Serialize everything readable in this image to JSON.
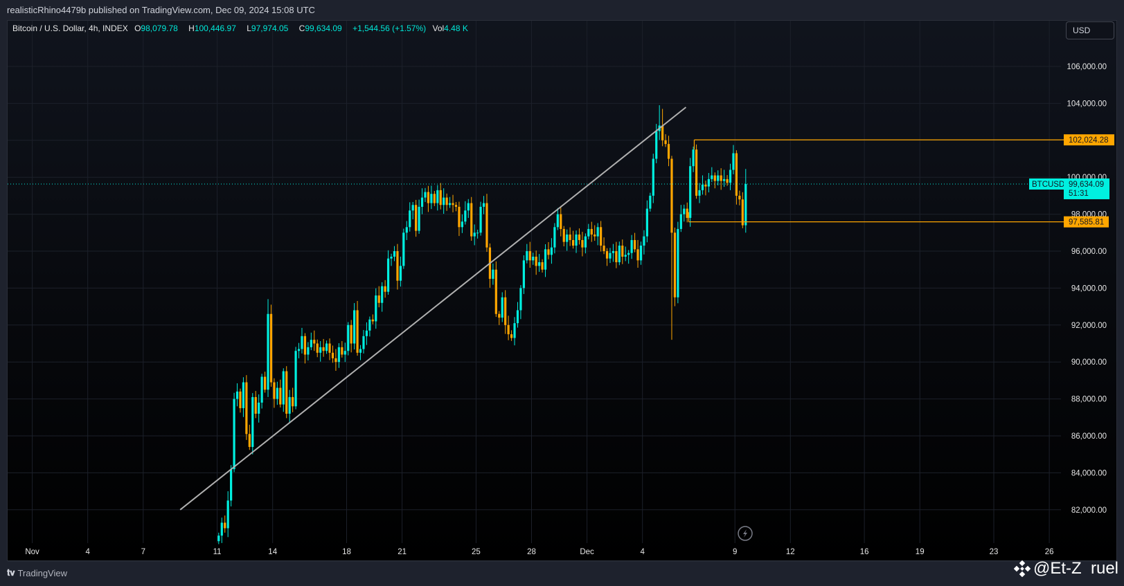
{
  "header": {
    "publisher_line": "realisticRhino4479b published on TradingView.com, Dec 09, 2024 15:08 UTC"
  },
  "legend": {
    "symbol": "Bitcoin / U.S. Dollar, 4h, INDEX",
    "open_label": "O",
    "open": "98,079.78",
    "high_label": "H",
    "high": "100,446.97",
    "low_label": "L",
    "low": "97,974.05",
    "close_label": "C",
    "close": "99,634.09",
    "change": "+1,544.56 (+1.57%)",
    "vol_label": "Vol",
    "vol": "4.48 K"
  },
  "currency_button": "USD",
  "footer": {
    "logo_text": "TradingView",
    "watermark": "@Et-Z  ruel"
  },
  "colors": {
    "up": "#00f0e0",
    "down": "#ffa600",
    "trendline": "#b0b0b0",
    "level": "#ffa600",
    "last_price": "#00f0e0"
  },
  "chart_data": {
    "type": "candlestick",
    "interval": "4h",
    "start": "Nov 11 00:00",
    "y_ticks": [
      "82,000.00",
      "84,000.00",
      "86,000.00",
      "88,000.00",
      "90,000.00",
      "92,000.00",
      "94,000.00",
      "96,000.00",
      "98,000.00",
      "100,000.00",
      "102,000.00",
      "104,000.00",
      "106,000.00"
    ],
    "ylim": [
      81000,
      107500
    ],
    "x_ticks": [
      {
        "label": "Nov",
        "day": -10
      },
      {
        "label": "4",
        "day": -7
      },
      {
        "label": "7",
        "day": -4
      },
      {
        "label": "11",
        "day": 0
      },
      {
        "label": "14",
        "day": 3
      },
      {
        "label": "18",
        "day": 7
      },
      {
        "label": "21",
        "day": 10
      },
      {
        "label": "25",
        "day": 14
      },
      {
        "label": "28",
        "day": 17
      },
      {
        "label": "Dec",
        "day": 20
      },
      {
        "label": "4",
        "day": 23
      },
      {
        "label": "9",
        "day": 28
      },
      {
        "label": "12",
        "day": 31
      },
      {
        "label": "16",
        "day": 35
      },
      {
        "label": "19",
        "day": 38
      },
      {
        "label": "23",
        "day": 42
      },
      {
        "label": "26",
        "day": 45
      }
    ],
    "first_open": 80300,
    "close_k": [
      80.6,
      81.3,
      81.0,
      82.5,
      84.2,
      88.0,
      88.4,
      87.5,
      88.9,
      86.1,
      85.4,
      88.1,
      87.2,
      87.8,
      89.2,
      88.5,
      92.6,
      88.9,
      88.0,
      88.6,
      87.7,
      89.5,
      87.2,
      88.1,
      87.6,
      90.6,
      90.7,
      91.4,
      90.4,
      90.8,
      91.2,
      91.0,
      90.5,
      90.8,
      90.6,
      91.0,
      90.5,
      90.2,
      90.0,
      90.8,
      90.4,
      90.6,
      92.0,
      91.0,
      92.8,
      90.5,
      90.7,
      91.4,
      91.7,
      92.3,
      92.2,
      93.6,
      93.2,
      94.1,
      93.8,
      95.6,
      95.7,
      96.0,
      94.4,
      95.2,
      97.0,
      97.3,
      98.2,
      98.5,
      97.1,
      98.4,
      98.9,
      99.2,
      98.6,
      99.1,
      98.6,
      99.3,
      98.5,
      98.9,
      98.5,
      98.6,
      98.5,
      98.4,
      97.3,
      97.6,
      98.2,
      98.6,
      96.8,
      97.0,
      97.0,
      98.4,
      98.6,
      96.2,
      94.5,
      95.0,
      92.6,
      92.4,
      93.5,
      92.0,
      91.5,
      91.3,
      92.1,
      92.8,
      94.0,
      95.5,
      96.0,
      95.5,
      95.7,
      95.2,
      95.4,
      95.0,
      96.1,
      95.8,
      96.2,
      97.3,
      98.0,
      97.2,
      96.5,
      96.9,
      96.6,
      96.3,
      96.9,
      96.6,
      96.2,
      96.8,
      97.2,
      96.9,
      96.8,
      97.3,
      96.3,
      96.0,
      95.6,
      95.9,
      96.0,
      95.4,
      96.3,
      95.7,
      95.8,
      95.9,
      96.6,
      96.1,
      95.5,
      96.3,
      96.8,
      98.3,
      99.0,
      101.0,
      102.5,
      102.8,
      102.0,
      101.8,
      101.0,
      97.0,
      93.5,
      97.2,
      98.0,
      98.3,
      97.8,
      100.6,
      101.5,
      99.0,
      99.3,
      99.6,
      99.5,
      99.9,
      100.1,
      99.8,
      100.1,
      99.8,
      99.9,
      99.7,
      100.4,
      101.3,
      99.0,
      98.8,
      97.4,
      99.634
    ],
    "wick_k": 0.4,
    "wick_overrides": [
      {
        "index": 16,
        "high": 93.4
      },
      {
        "index": 143,
        "high": 103.9
      },
      {
        "index": 144,
        "high": 103.7
      },
      {
        "index": 147,
        "low": 91.2
      },
      {
        "index": 171,
        "high": 100.45
      }
    ],
    "trendline": {
      "from": {
        "day": -2,
        "price": 82000
      },
      "to": {
        "day": 25.35,
        "price": 103790
      }
    },
    "levels": [
      {
        "price": 102024.28,
        "label": "102,024.28",
        "from_day": 25.8
      },
      {
        "price": 97585.81,
        "label": "97,585.81",
        "from_day": 25.5
      }
    ],
    "last_price": {
      "price": 99634.09,
      "symbol": "BTCUSD",
      "label": "99,634.09",
      "countdown": "51:31"
    }
  }
}
